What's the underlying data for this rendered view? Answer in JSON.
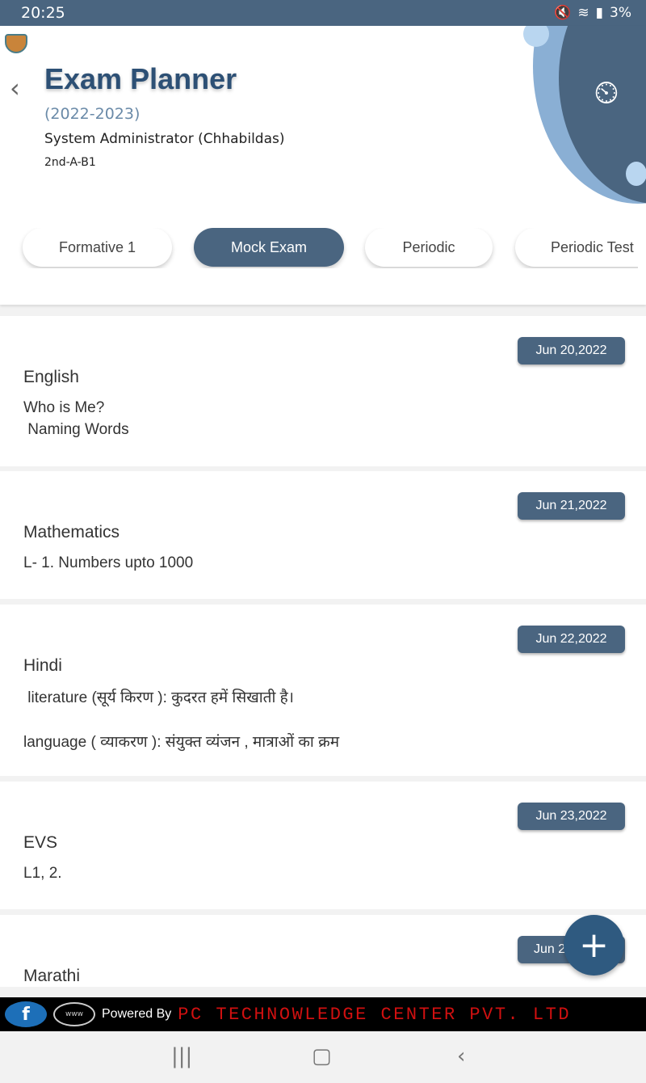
{
  "status_bar": {
    "time": "20:25",
    "battery": "3%"
  },
  "header": {
    "title": "Exam Planner",
    "year": "(2022-2023)",
    "user": "System Administrator (Chhabildas)",
    "class": "2nd-A-B1"
  },
  "tabs": [
    {
      "label": "Formative 1",
      "active": false
    },
    {
      "label": "Mock Exam",
      "active": true
    },
    {
      "label": "Periodic",
      "active": false
    },
    {
      "label": "Periodic Test",
      "active": false
    }
  ],
  "exams": [
    {
      "date": "Jun 20,2022",
      "subject": "English",
      "lines": [
        "Who is Me?",
        " Naming Words"
      ]
    },
    {
      "date": "Jun 21,2022",
      "subject": "Mathematics",
      "lines": [
        "L- 1. Numbers upto 1000"
      ]
    },
    {
      "date": "Jun 22,2022",
      "subject": "Hindi",
      "lines": [
        " literature (सूर्य किरण ): कुदरत हमें सिखाती है।",
        "language ( व्याकरण ): संयुक्त व्यंजन , मात्राओं का क्रम"
      ]
    },
    {
      "date": "Jun 23,2022",
      "subject": "EVS",
      "lines": [
        "L1, 2."
      ]
    },
    {
      "date": "Jun 2",
      "subject": "Marathi",
      "lines": []
    }
  ],
  "fab": {
    "label": "+"
  },
  "footer": {
    "powered_by": "Powered By",
    "company": "PC TECHNOWLEDGE CENTER PVT. LTD",
    "fb": "f",
    "www": "www"
  },
  "colors": {
    "primary": "#4a6580",
    "title": "#2d5075",
    "company": "#d01010"
  }
}
